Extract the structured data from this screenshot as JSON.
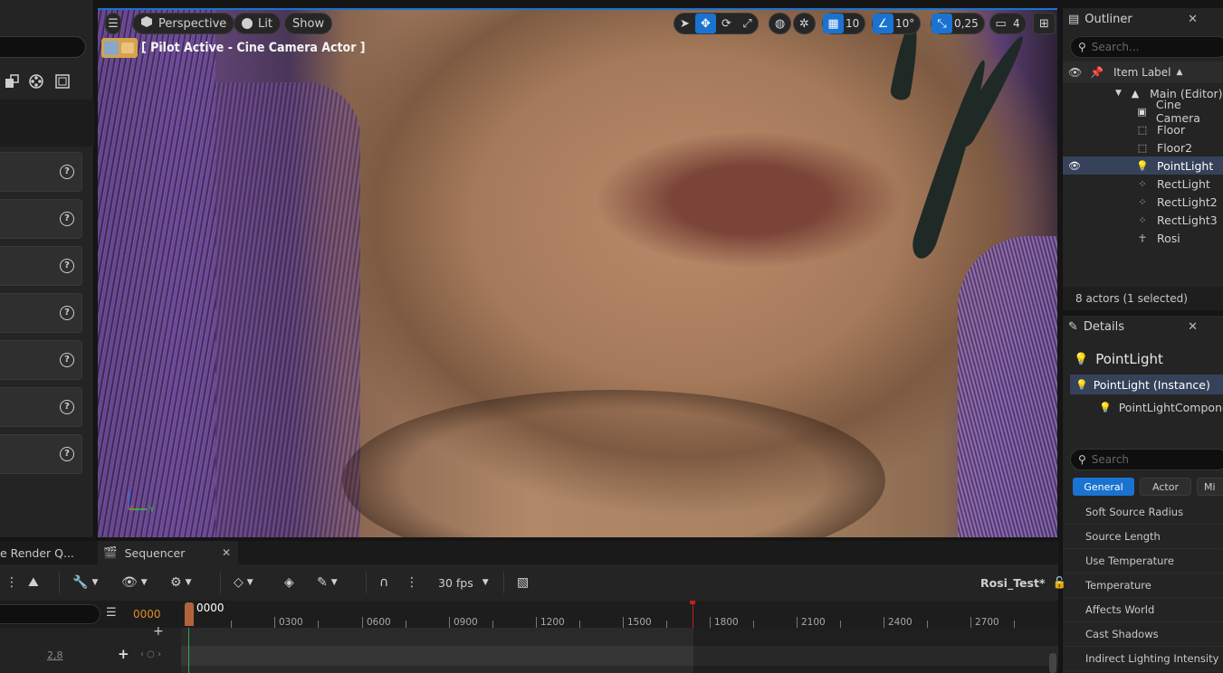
{
  "viewport": {
    "perspective_label": "Perspective",
    "lit_label": "Lit",
    "show_label": "Show",
    "pilot_label": "[ Pilot Active - Cine Camera Actor ]",
    "grid_snap_value": "10",
    "rotation_snap_value": "10°",
    "scale_snap_value": "0,25",
    "camera_speed_value": "4",
    "axis_y_label": "Y"
  },
  "outliner": {
    "title": "Outliner",
    "search_placeholder": "Search...",
    "column_label": "Item Label",
    "sort_glyph": "▲",
    "root_label": "Main (Editor)",
    "items": [
      {
        "label": "Cine Camera",
        "icon": "camera-icon"
      },
      {
        "label": "Floor",
        "icon": "mesh-icon"
      },
      {
        "label": "Floor2",
        "icon": "mesh-icon"
      },
      {
        "label": "PointLight",
        "icon": "lightbulb-icon"
      },
      {
        "label": "RectLight",
        "icon": "rect-light-icon"
      },
      {
        "label": "RectLight2",
        "icon": "rect-light-icon"
      },
      {
        "label": "RectLight3",
        "icon": "rect-light-icon"
      },
      {
        "label": "Rosi",
        "icon": "skeleton-icon"
      }
    ],
    "footer": "8 actors (1 selected)"
  },
  "details": {
    "title": "Details",
    "actor_name": "PointLight",
    "component_selected": "PointLight (Instance)",
    "component_child": "PointLightComponen",
    "search_placeholder": "Search",
    "filter_tabs": [
      "General",
      "Actor",
      "Mi"
    ],
    "properties": [
      "Soft Source Radius",
      "Source Length",
      "Use Temperature",
      "Temperature",
      "Affects World",
      "Cast Shadows",
      "Indirect Lighting Intensity"
    ]
  },
  "bottom_tabs": {
    "render_queue_label": "e Render Q...",
    "sequencer_label": "Sequencer"
  },
  "sequencer": {
    "fps_label": "30 fps",
    "sequence_name": "Rosi_Test*",
    "current_frame": "0000",
    "playhead_label": "0000",
    "ruler_labels": [
      "0300",
      "0600",
      "0900",
      "1200",
      "1500",
      "1800",
      "2100",
      "2400",
      "2700"
    ],
    "track_value": "2,8"
  },
  "colors": {
    "accent": "#1a73d0",
    "selection": "#354259",
    "frame_orange": "#e08a2a"
  }
}
